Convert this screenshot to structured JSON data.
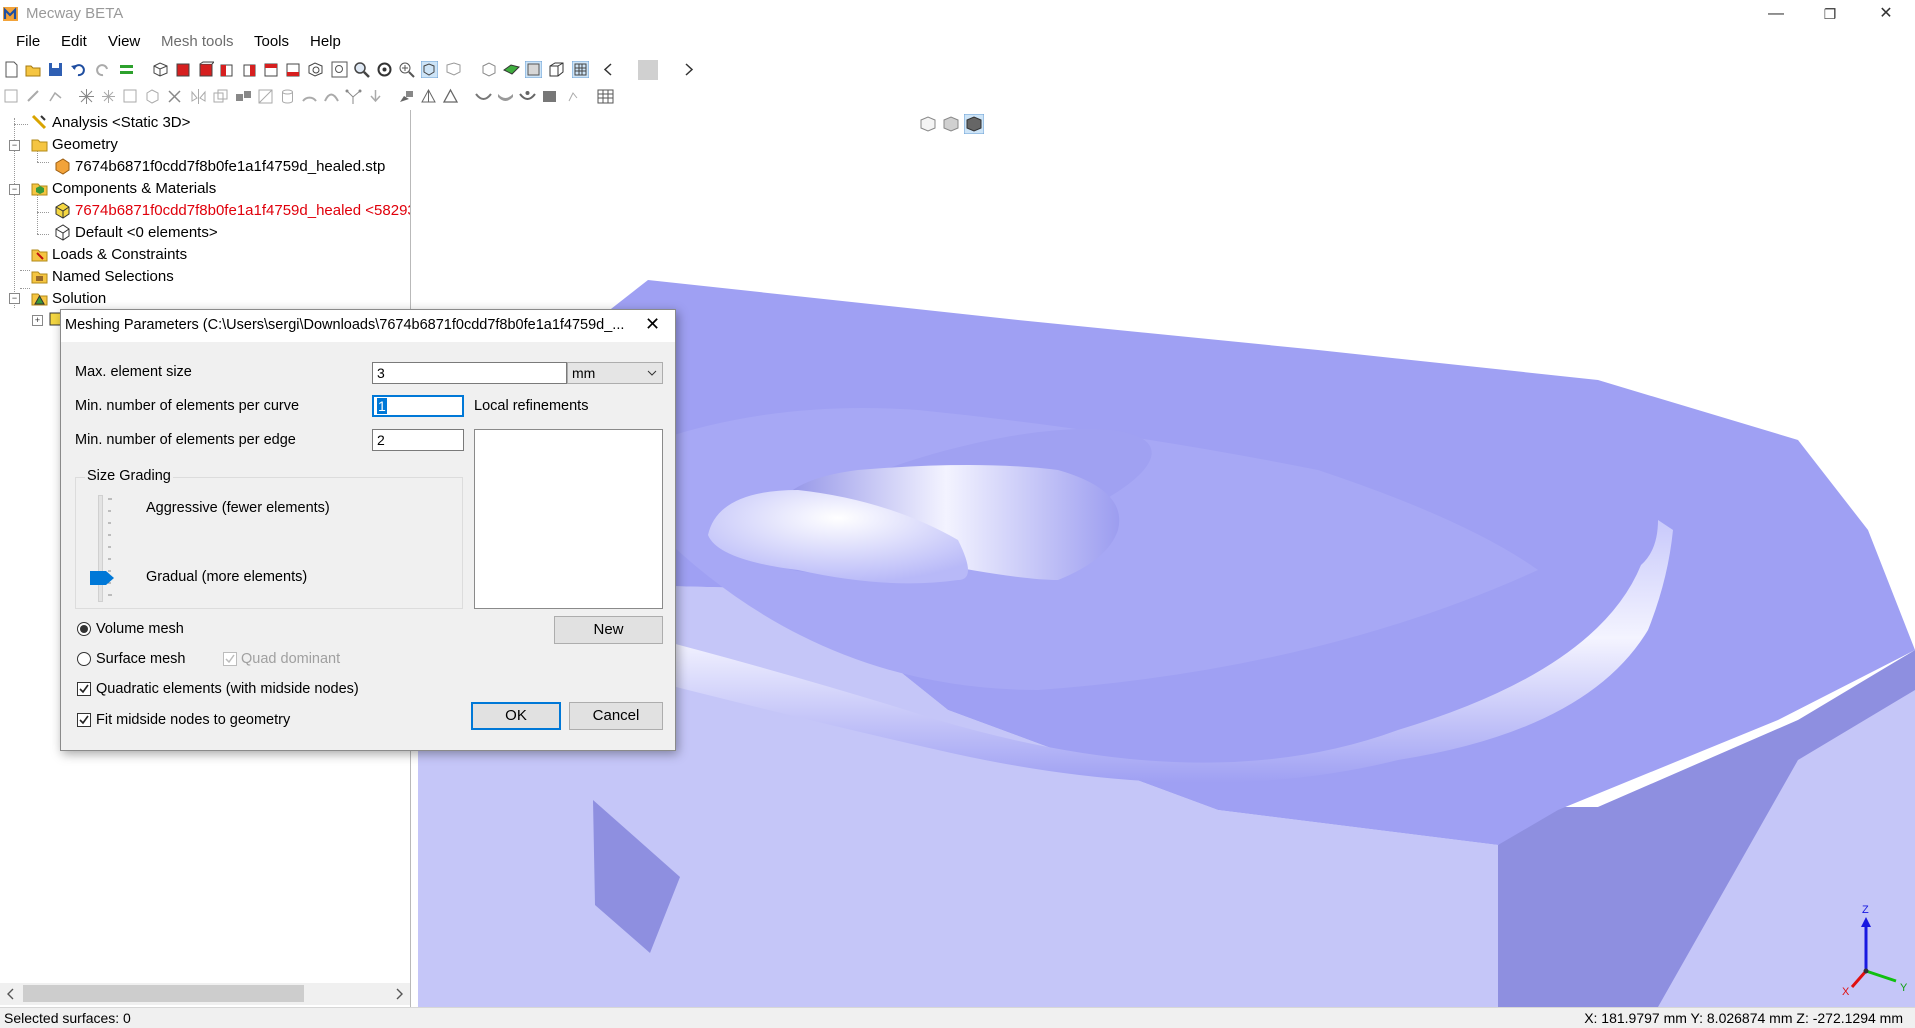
{
  "window": {
    "title": "Mecway BETA",
    "minimize_glyph": "—",
    "maximize_glyph": "❐",
    "close_glyph": "✕"
  },
  "menu": [
    "File",
    "Edit",
    "View",
    "Mesh tools",
    "Tools",
    "Help"
  ],
  "tree": {
    "analysis": "Analysis <Static 3D>",
    "geometry": "Geometry",
    "geometry_file": "7674b6871f0cdd7f8b0fe1a1f4759d_healed.stp",
    "components": "Components & Materials",
    "component_item": "7674b6871f0cdd7f8b0fe1a1f4759d_healed <58293",
    "default_item": "Default <0 elements>",
    "loads": "Loads & Constraints",
    "named": "Named Selections",
    "solution": "Solution"
  },
  "dialog": {
    "title": "Meshing Parameters (C:\\Users\\sergi\\Downloads\\7674b6871f0cdd7f8b0fe1a1f4759d_...",
    "close_glyph": "✕",
    "max_element_size_label": "Max. element size",
    "max_element_size_value": "3",
    "unit": "mm",
    "min_per_curve_label": "Min. number of elements per curve",
    "min_per_curve_value": "1",
    "min_per_edge_label": "Min. number of elements per edge",
    "min_per_edge_value": "2",
    "local_refinements_label": "Local refinements",
    "size_grading_label": "Size Grading",
    "aggressive_label": "Aggressive (fewer elements)",
    "gradual_label": "Gradual (more elements)",
    "volume_mesh_label": "Volume mesh",
    "surface_mesh_label": "Surface mesh",
    "quad_dominant_label": "Quad dominant",
    "quadratic_label": "Quadratic elements (with midside nodes)",
    "fit_midside_label": "Fit midside nodes to geometry",
    "new_label": "New",
    "ok_label": "OK",
    "cancel_label": "Cancel"
  },
  "status": {
    "selected": "Selected surfaces: 0",
    "coords": "X: 181.9797 mm Y: 8.026874 mm Z: -272.1294 mm"
  },
  "triad": {
    "x": "X",
    "y": "Y",
    "z": "Z"
  },
  "colors": {
    "model_top": "#9fa0f3",
    "model_side": "#c5c6f8",
    "model_dark": "#8e8fe0",
    "tree_red": "#e0000b",
    "accent": "#0078d7"
  }
}
